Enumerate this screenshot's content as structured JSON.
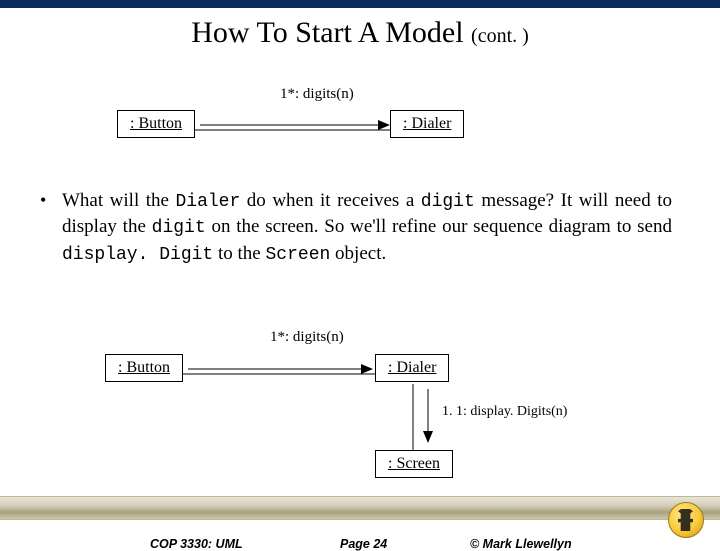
{
  "title": {
    "main": "How To Start A Model ",
    "cont": "(cont. )"
  },
  "diagram1": {
    "button": ": Button",
    "dialer": ": Dialer",
    "msg": "1*: digits(n)"
  },
  "body": {
    "t1": "What will the ",
    "c1": "Dialer",
    "t2": " do when it receives a ",
    "c2": "digit",
    "t3": " message?  It will need to display the ",
    "c3": "digit",
    "t4": " on the screen.  So we'll refine our sequence diagram to send ",
    "c4": "display. Digit",
    "t5": " to the ",
    "c5": "Screen",
    "t6": " object."
  },
  "diagram2": {
    "button": ": Button",
    "dialer": ": Dialer",
    "screen": ": Screen",
    "msg1": "1*: digits(n)",
    "msg2": "1. 1: display. Digits(n)"
  },
  "footer": {
    "course": "COP 3330:  UML",
    "page": "Page 24",
    "author": "© Mark Llewellyn"
  },
  "chart_data": {
    "type": "table",
    "note": "UML collaboration diagrams",
    "diagram_1": {
      "objects": [
        ": Button",
        ": Dialer"
      ],
      "messages": [
        {
          "from": ": Button",
          "to": ": Dialer",
          "label": "1*: digits(n)"
        }
      ]
    },
    "diagram_2": {
      "objects": [
        ": Button",
        ": Dialer",
        ": Screen"
      ],
      "messages": [
        {
          "from": ": Button",
          "to": ": Dialer",
          "label": "1*: digits(n)"
        },
        {
          "from": ": Dialer",
          "to": ": Screen",
          "label": "1. 1: display. Digits(n)"
        }
      ]
    }
  }
}
